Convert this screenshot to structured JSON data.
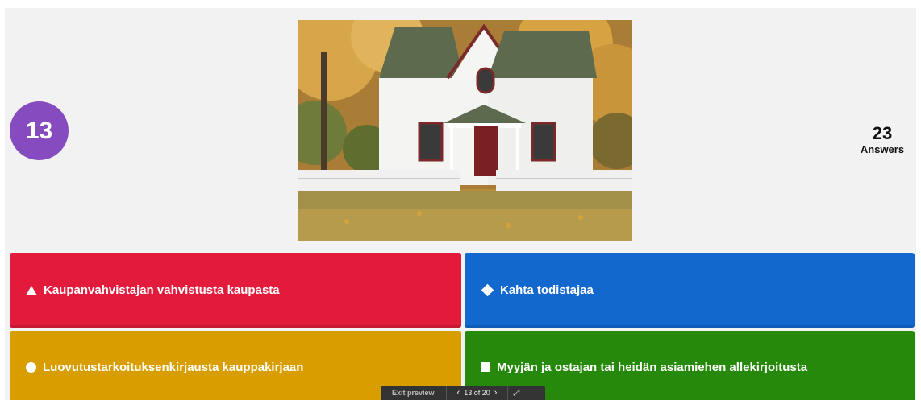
{
  "question": {
    "number": "13",
    "answers_count": "23",
    "answers_label": "Answers"
  },
  "image": {
    "description_icon": "house-photo"
  },
  "answers": [
    {
      "shape": "triangle-icon",
      "label": "Kaupanvahvistajan vahvistusta kaupasta",
      "color": "#e21b3c"
    },
    {
      "shape": "diamond-icon",
      "label": "Kahta todistajaa",
      "color": "#1368ce"
    },
    {
      "shape": "circle-icon",
      "label": "Luovutustarkoituksenkirjausta kauppakirjaan",
      "color": "#d89e00"
    },
    {
      "shape": "square-icon",
      "label": "Myyjän ja ostajan tai heidän asiamiehen allekirjoitusta",
      "color": "#26890c"
    }
  ],
  "preview_bar": {
    "exit_label": "Exit preview",
    "counter": "13 of 20",
    "prev_icon": "chevron-left-icon",
    "next_icon": "chevron-right-icon",
    "fullscreen_icon": "fullscreen-icon"
  },
  "colors": {
    "question_badge": "#864cbf",
    "background": "#f2f2f2"
  }
}
